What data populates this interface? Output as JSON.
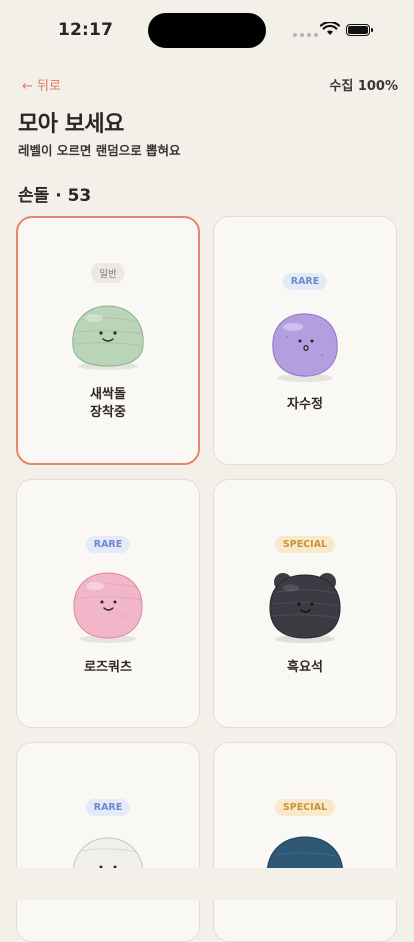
{
  "status": {
    "time": "12:17"
  },
  "header": {
    "back_label": "← 뒤로",
    "progress_label": "수집 100%"
  },
  "title": "모아 보세요",
  "subtitle": "레벨이 오르면 랜덤으로 뽑혀요",
  "section": "손돌 · 53",
  "cards": [
    {
      "badge": "일반",
      "name_line1": "새싹돌",
      "name_line2": "장착중",
      "stone_color": "#b9d4b6"
    },
    {
      "badge": "RARE",
      "name_line1": "자수정",
      "stone_color": "#b39ee0"
    },
    {
      "badge": "RARE",
      "name_line1": "로즈쿼츠",
      "stone_color": "#f1b7c8"
    },
    {
      "badge": "SPECIAL",
      "name_line1": "흑요석",
      "stone_color": "#3b3b44"
    },
    {
      "badge": "RARE",
      "stone_color": "#f0efeb"
    },
    {
      "badge": "SPECIAL",
      "stone_color": "#2f5875"
    }
  ],
  "colors": {
    "accent": "#e07a5f",
    "rare": "#6f89cf",
    "special": "#cc9334"
  }
}
